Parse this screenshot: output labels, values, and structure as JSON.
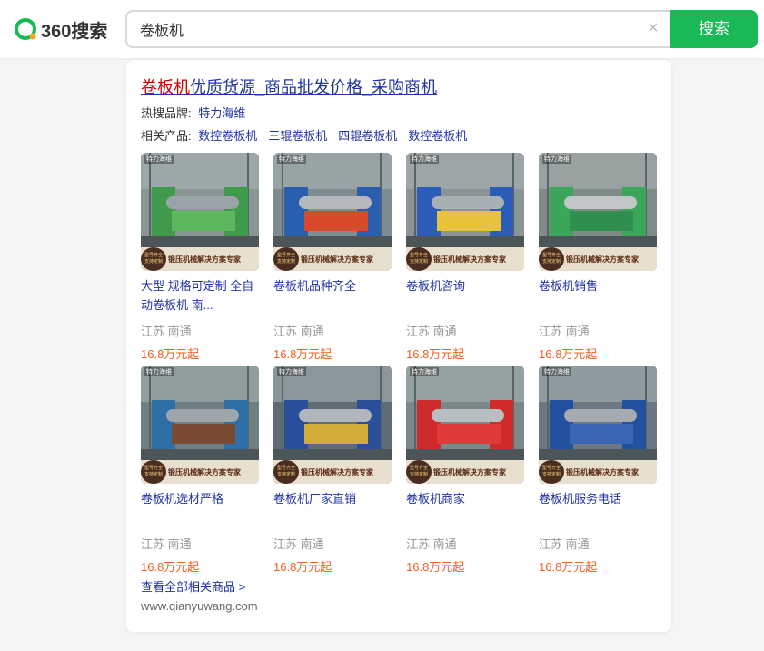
{
  "header": {
    "logo_text": "360搜索",
    "search_value": "卷板机",
    "search_button": "搜索",
    "clear_symbol": "×",
    "accent_color": "#19b955"
  },
  "result": {
    "title_highlight": "卷板机",
    "title_rest": "优质货源_商品批发价格_采购商机",
    "brand_label": "热搜品牌:",
    "brand_link": "特力海维",
    "products_label": "相关产品:",
    "products": [
      "数控卷板机",
      "三辊卷板机",
      "四辊卷板机",
      "数控卷板机"
    ],
    "items": [
      {
        "title": "大型 规格可定制 全自动卷板机 南...",
        "location": "江苏 南通",
        "price": "16.8万元起",
        "image_theme": "green-machine"
      },
      {
        "title": "卷板机品种齐全",
        "location": "江苏 南通",
        "price": "16.8万元起",
        "image_theme": "blue-red-machine"
      },
      {
        "title": "卷板机咨询",
        "location": "江苏 南通",
        "price": "16.8万元起",
        "image_theme": "blue-machine"
      },
      {
        "title": "卷板机销售",
        "location": "江苏 南通",
        "price": "16.8万元起",
        "image_theme": "green-roller"
      },
      {
        "title": "卷板机选材严格",
        "location": "江苏 南通",
        "price": "16.8万元起",
        "image_theme": "blue-plate"
      },
      {
        "title": "卷板机厂家直销",
        "location": "江苏 南通",
        "price": "16.8万元起",
        "image_theme": "blue-roller"
      },
      {
        "title": "卷板机商家",
        "location": "江苏 南通",
        "price": "16.8万元起",
        "image_theme": "red-machine"
      },
      {
        "title": "卷板机服务电话",
        "location": "江苏 南通",
        "price": "16.8万元起",
        "image_theme": "blue-long"
      }
    ],
    "banner_text": "锻压机械解决方案专家",
    "badge_text": "型号齐全 支持定制",
    "brand_mark": "特力海维",
    "more_link": "查看全部相关商品 >",
    "site_url": "www.qianyuwang.com"
  }
}
